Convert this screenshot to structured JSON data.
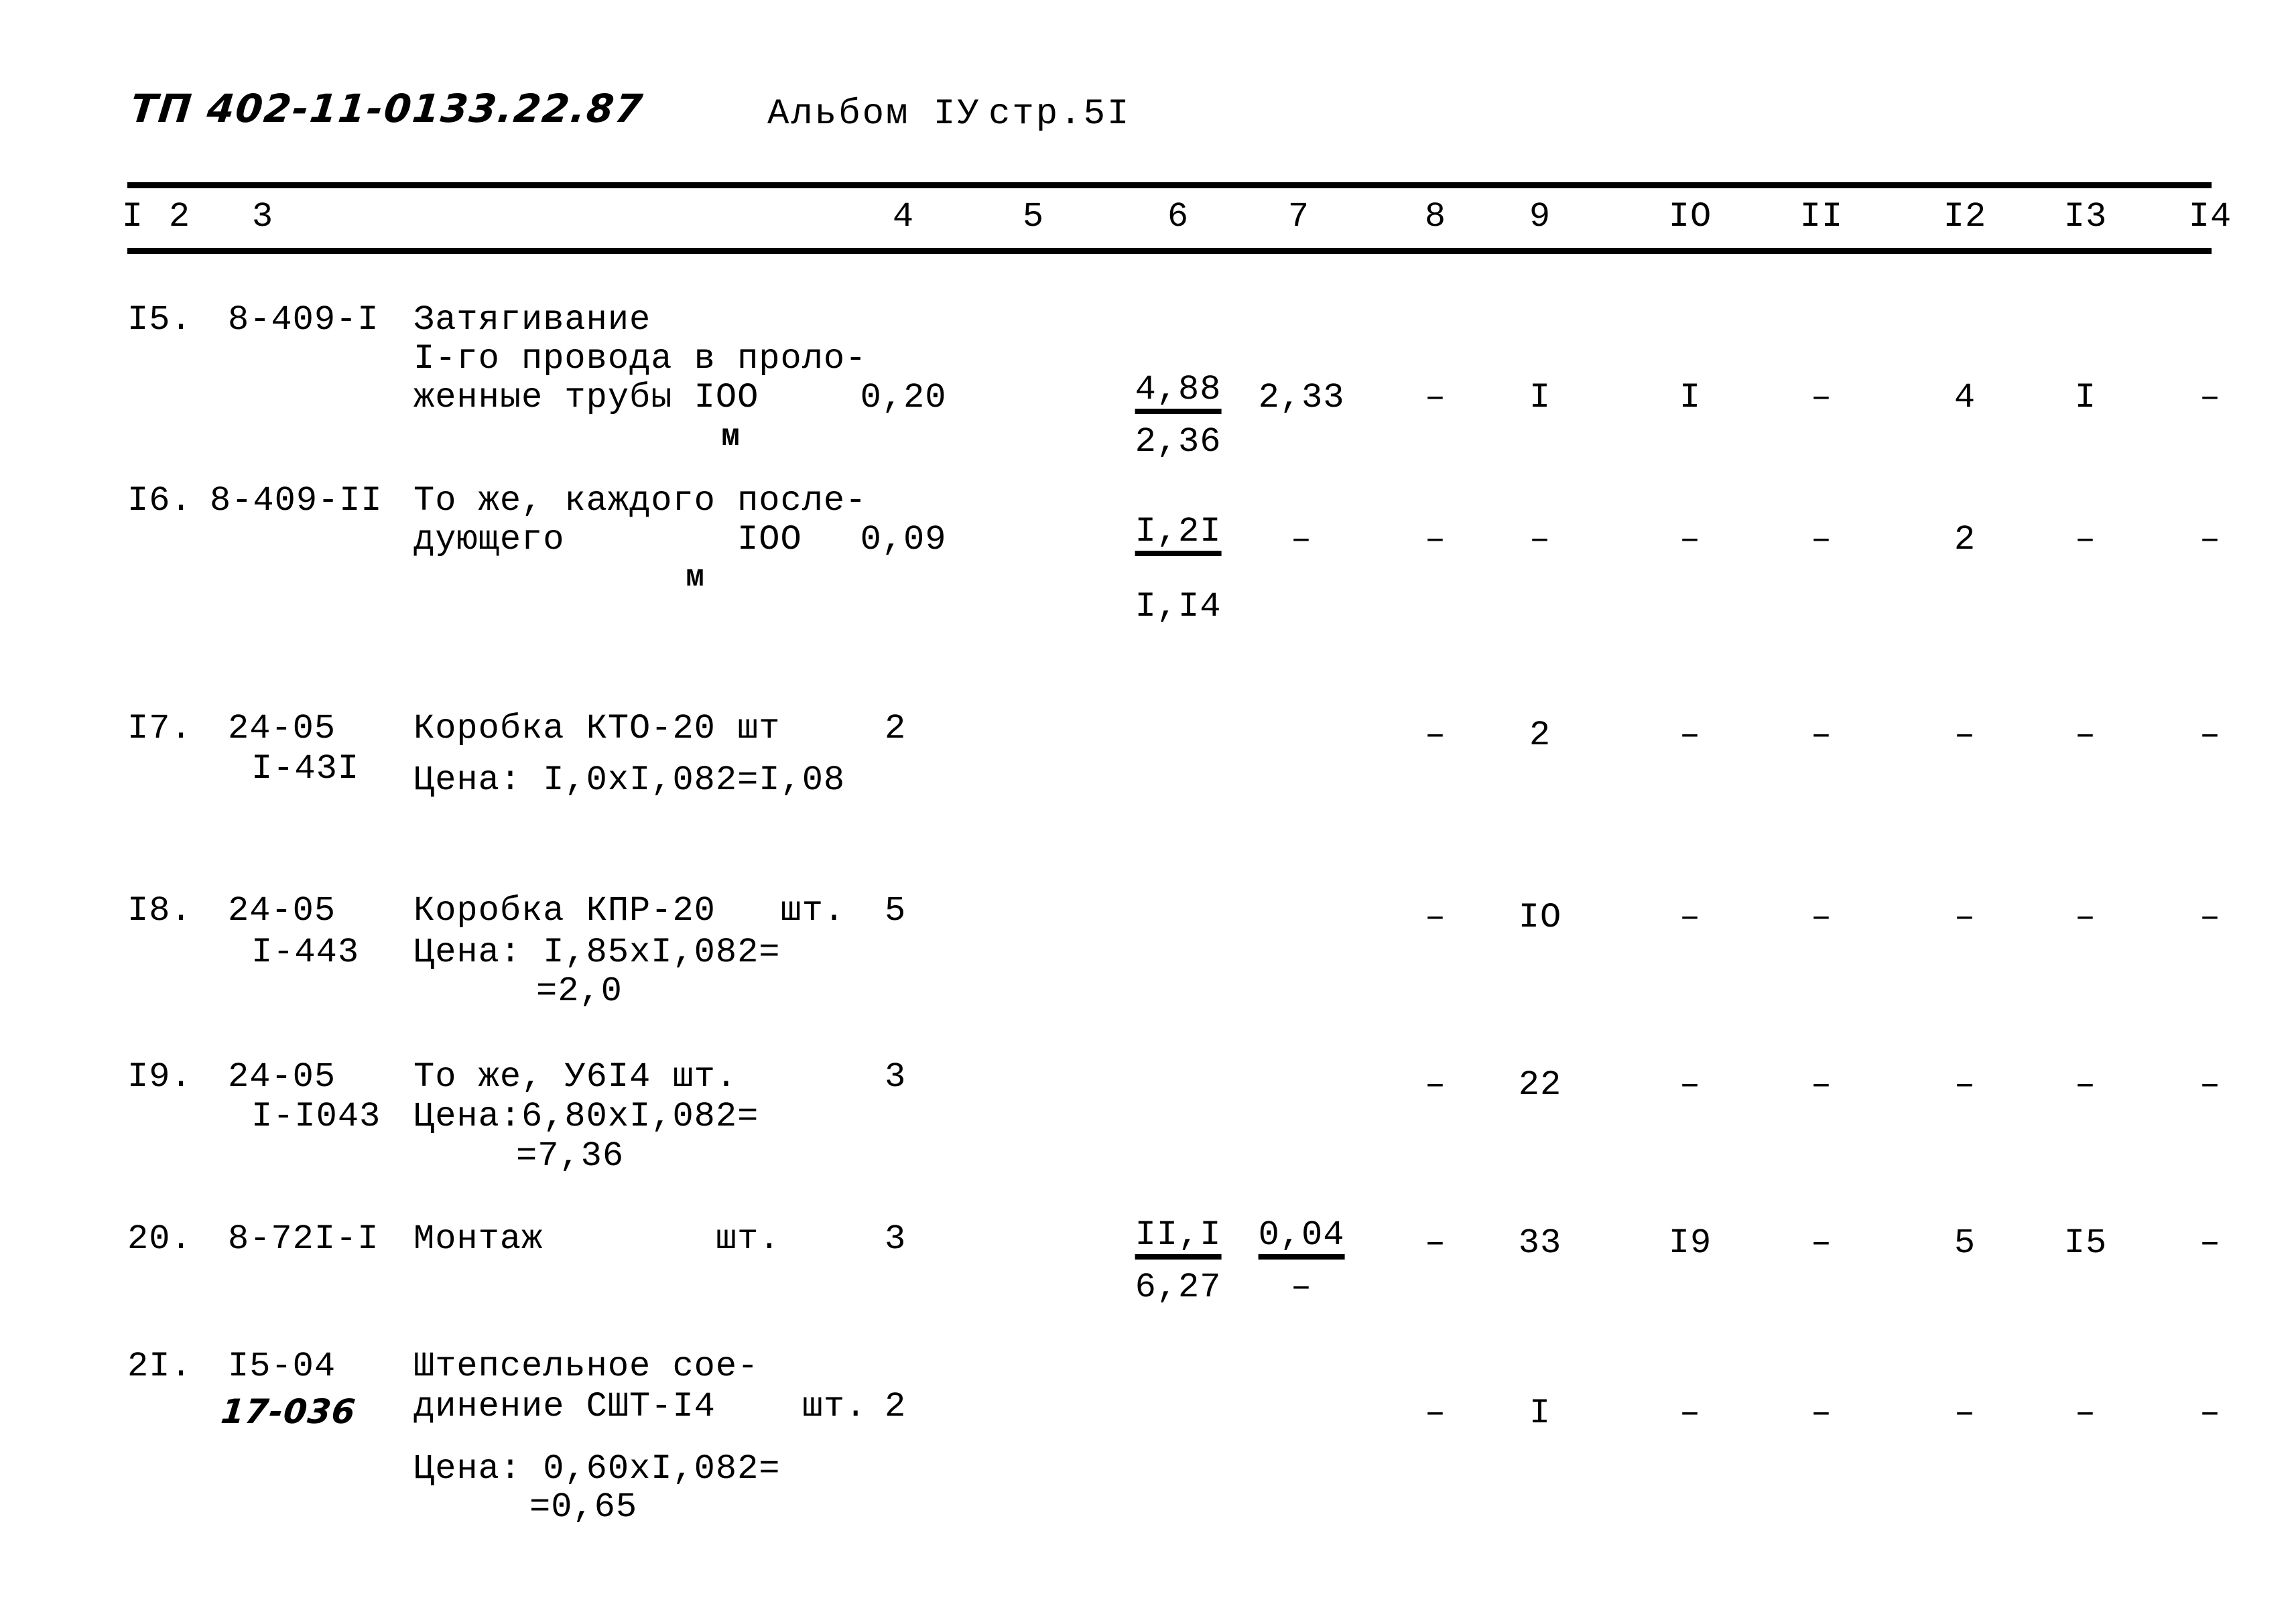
{
  "header": {
    "doc_code": "ТП 402-11-0133.22.87",
    "album": "Альбом IУ",
    "page": "стр.5I"
  },
  "table": {
    "column_headers": [
      "I",
      "2",
      "3",
      "4",
      "5",
      "6",
      "7",
      "8",
      "9",
      "IO",
      "II",
      "I2",
      "I3",
      "I4"
    ],
    "rows": [
      {
        "num": "I5.",
        "code": "8-409-I",
        "code2": "",
        "desc_lines": [
          "Затягивание",
          "I-го провода в проло-",
          "женные трубы IOO"
        ],
        "unit_sub": "м",
        "price_lines": [],
        "col4": "0,20",
        "col5": "",
        "col6_num": "4,88",
        "col6_den": "2,36",
        "col7": "2,33",
        "col7_den": "",
        "col8": "–",
        "col9": "I",
        "col10": "I",
        "col11": "–",
        "col12": "4",
        "col13": "I",
        "col14": "–"
      },
      {
        "num": "I6.",
        "code": "8-409-II",
        "code2": "",
        "desc_lines": [
          "То же, каждого после-",
          "дующего        IOO"
        ],
        "unit_sub": "м",
        "price_lines": [],
        "col4": "0,09",
        "col5": "",
        "col6_num": "I,2I",
        "col6_den": "I,I4",
        "col7": "–",
        "col7_den": "",
        "col8": "–",
        "col9": "–",
        "col10": "–",
        "col11": "–",
        "col12": "2",
        "col13": "–",
        "col14": "–"
      },
      {
        "num": "I7.",
        "code": "24-05",
        "code2": "I-43I",
        "desc_lines": [
          "Коробка КТО-20 шт"
        ],
        "unit_sub": "",
        "price_lines": [
          "Цена: I,0xI,082=I,08"
        ],
        "col4": "2",
        "col5": "",
        "col6_num": "",
        "col6_den": "",
        "col7": "",
        "col7_den": "",
        "col8": "–",
        "col9": "2",
        "col10": "–",
        "col11": "–",
        "col12": "–",
        "col13": "–",
        "col14": "–"
      },
      {
        "num": "I8.",
        "code": "24-05",
        "code2": "I-443",
        "desc_lines": [
          "Коробка КПР-20   шт."
        ],
        "unit_sub": "",
        "price_lines": [
          "Цена: I,85xI,082=",
          "=2,0"
        ],
        "col4": "5",
        "col5": "",
        "col6_num": "",
        "col6_den": "",
        "col7": "",
        "col7_den": "",
        "col8": "–",
        "col9": "IO",
        "col10": "–",
        "col11": "–",
        "col12": "–",
        "col13": "–",
        "col14": "–"
      },
      {
        "num": "I9.",
        "code": "24-05",
        "code2": "I-I043",
        "desc_lines": [
          "То же, У6I4 шт."
        ],
        "unit_sub": "",
        "price_lines": [
          "Цена:6,80xI,082=",
          "=7,36"
        ],
        "col4": "3",
        "col5": "",
        "col6_num": "",
        "col6_den": "",
        "col7": "",
        "col7_den": "",
        "col8": "–",
        "col9": "22",
        "col10": "–",
        "col11": "–",
        "col12": "–",
        "col13": "–",
        "col14": "–"
      },
      {
        "num": "20.",
        "code": "8-72I-I",
        "code2": "",
        "desc_lines": [
          "Монтаж        шт."
        ],
        "unit_sub": "",
        "price_lines": [],
        "col4": "3",
        "col5": "",
        "col6_num": "II,I",
        "col6_den": "6,27",
        "col7": "0,04",
        "col7_den": "–",
        "col8": "–",
        "col9": "33",
        "col10": "I9",
        "col11": "–",
        "col12": "5",
        "col13": "I5",
        "col14": "–"
      },
      {
        "num": "2I.",
        "code": "I5-04",
        "code2": "17-036",
        "desc_lines": [
          "Штепсельное сое-",
          "динение СШТ-I4    шт."
        ],
        "unit_sub": "",
        "price_lines": [
          "Цена: 0,60xI,082=",
          "=0,65"
        ],
        "col4": "2",
        "col5": "",
        "col6_num": "",
        "col6_den": "",
        "col7": "",
        "col7_den": "",
        "col8": "–",
        "col9": "I",
        "col10": "–",
        "col11": "–",
        "col12": "–",
        "col13": "–",
        "col14": "–"
      }
    ]
  }
}
